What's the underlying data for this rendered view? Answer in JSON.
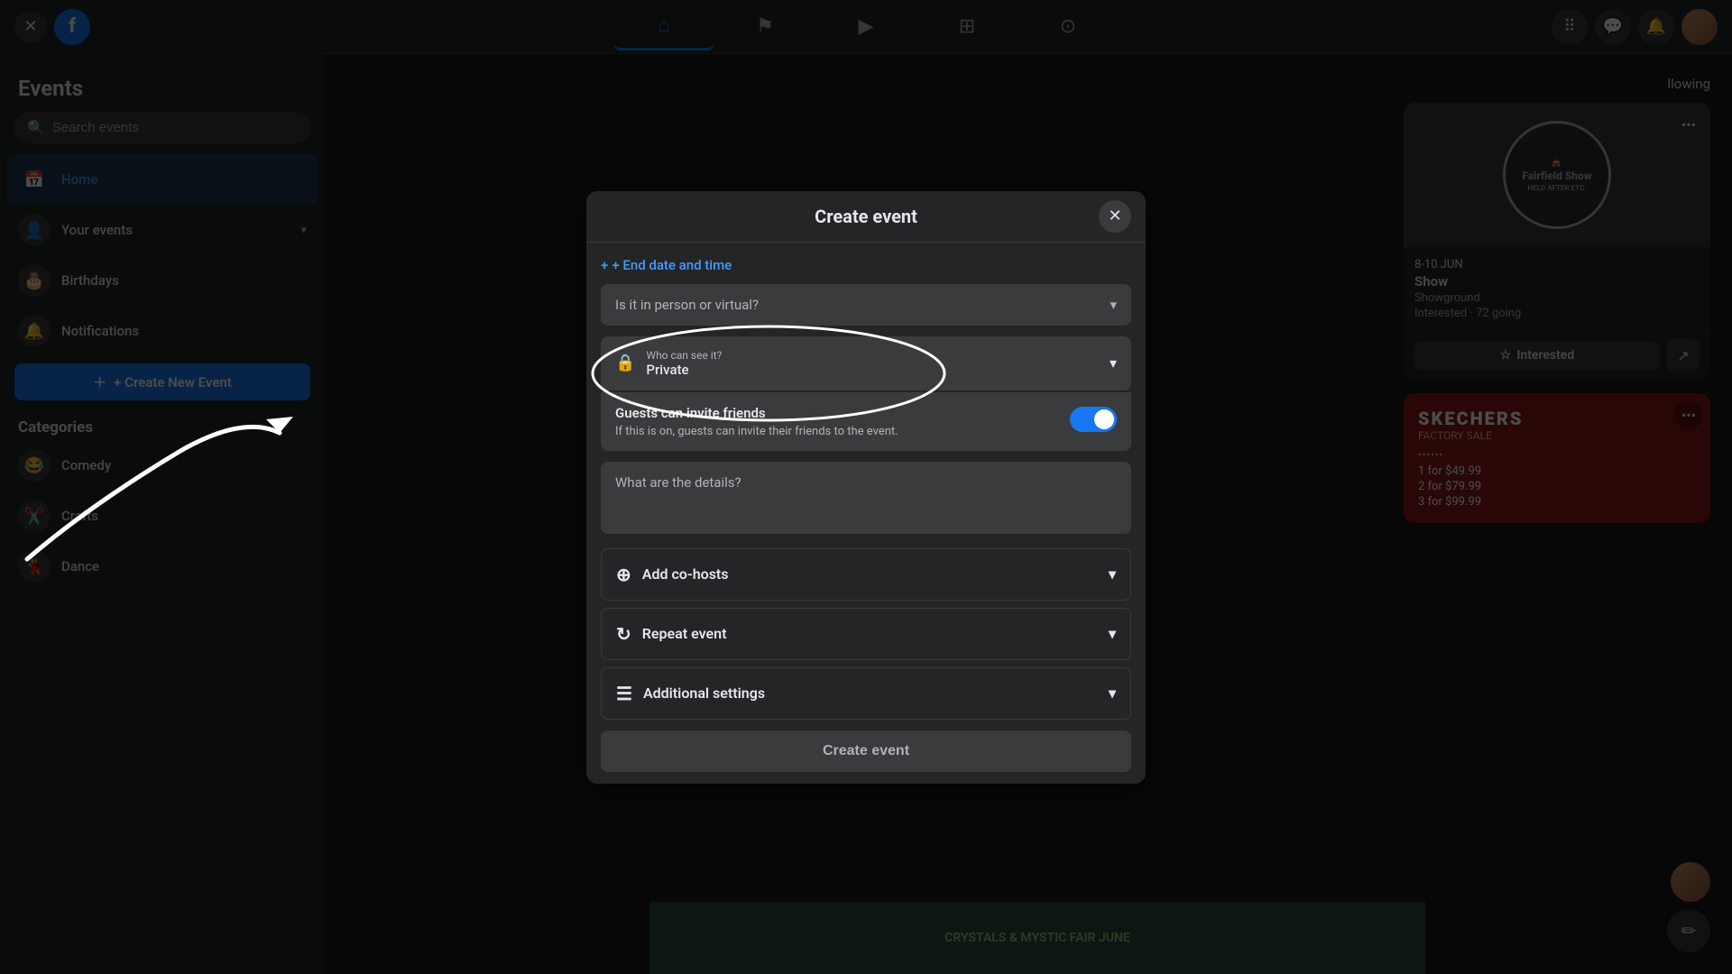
{
  "app": {
    "title": "Facebook Events"
  },
  "topnav": {
    "logo": "f",
    "close_label": "✕",
    "icons": [
      {
        "name": "home",
        "symbol": "⌂",
        "active": false
      },
      {
        "name": "flag",
        "symbol": "⚑",
        "active": false
      },
      {
        "name": "play",
        "symbol": "▶",
        "active": false
      },
      {
        "name": "marketplace",
        "symbol": "🏪",
        "active": false
      },
      {
        "name": "gamepad",
        "symbol": "🎮",
        "active": false
      }
    ],
    "right_icons": [
      {
        "name": "grid",
        "symbol": "⠿"
      },
      {
        "name": "messenger",
        "symbol": "💬"
      },
      {
        "name": "bell",
        "symbol": "🔔"
      }
    ]
  },
  "sidebar": {
    "title": "Events",
    "search_placeholder": "Search events",
    "items": [
      {
        "label": "Home",
        "icon": "📅"
      },
      {
        "label": "Your events",
        "icon": "👤"
      },
      {
        "label": "Birthdays",
        "icon": "🎂"
      },
      {
        "label": "Notifications",
        "icon": "🔔"
      }
    ],
    "create_button": "+ Create New Event",
    "categories_label": "Categories",
    "categories": [
      {
        "label": "Comedy",
        "icon": "😂"
      },
      {
        "label": "Crafts",
        "icon": "✂️"
      },
      {
        "label": "Dance",
        "icon": "💃"
      }
    ]
  },
  "modal": {
    "title": "Create event",
    "close_label": "✕",
    "end_date_link": "+ End date and time",
    "location_placeholder": "Is it in person or virtual?",
    "privacy": {
      "label": "Who can see it?",
      "value": "Private"
    },
    "guests": {
      "title": "Guests can invite friends",
      "description": "If this is on, guests can invite their friends to the event.",
      "toggle_on": true
    },
    "details_placeholder": "What are the details?",
    "accordion_items": [
      {
        "label": "Add co-hosts",
        "icon": "⊕"
      },
      {
        "label": "Repeat event",
        "icon": "↻"
      },
      {
        "label": "Additional settings",
        "icon": "☰"
      }
    ],
    "submit_label": "Create event"
  },
  "event_cards": [
    {
      "image_type": "fairfield",
      "date": "8-10 JUN",
      "name": "Show",
      "venue": "Showground",
      "going": "Interested · 72 going",
      "interested_label": "Interested",
      "share_icon": "↗"
    },
    {
      "image_type": "skechers",
      "brand": "SKECHERS",
      "subtitle": "FACTORY SALE",
      "prices": [
        "1 for $49.99",
        "2 for $79.99",
        "3 for $99.99"
      ]
    }
  ],
  "following_label": "llowing",
  "bottom_strip": "CRYSTALS & MYSTIC FAIR JUNE",
  "compose_icon": "✏",
  "fairfield_show_text": "Fairfield Show",
  "fairfield_tagline": "HELD AFTER ETC.",
  "annotation_circle_text": ""
}
